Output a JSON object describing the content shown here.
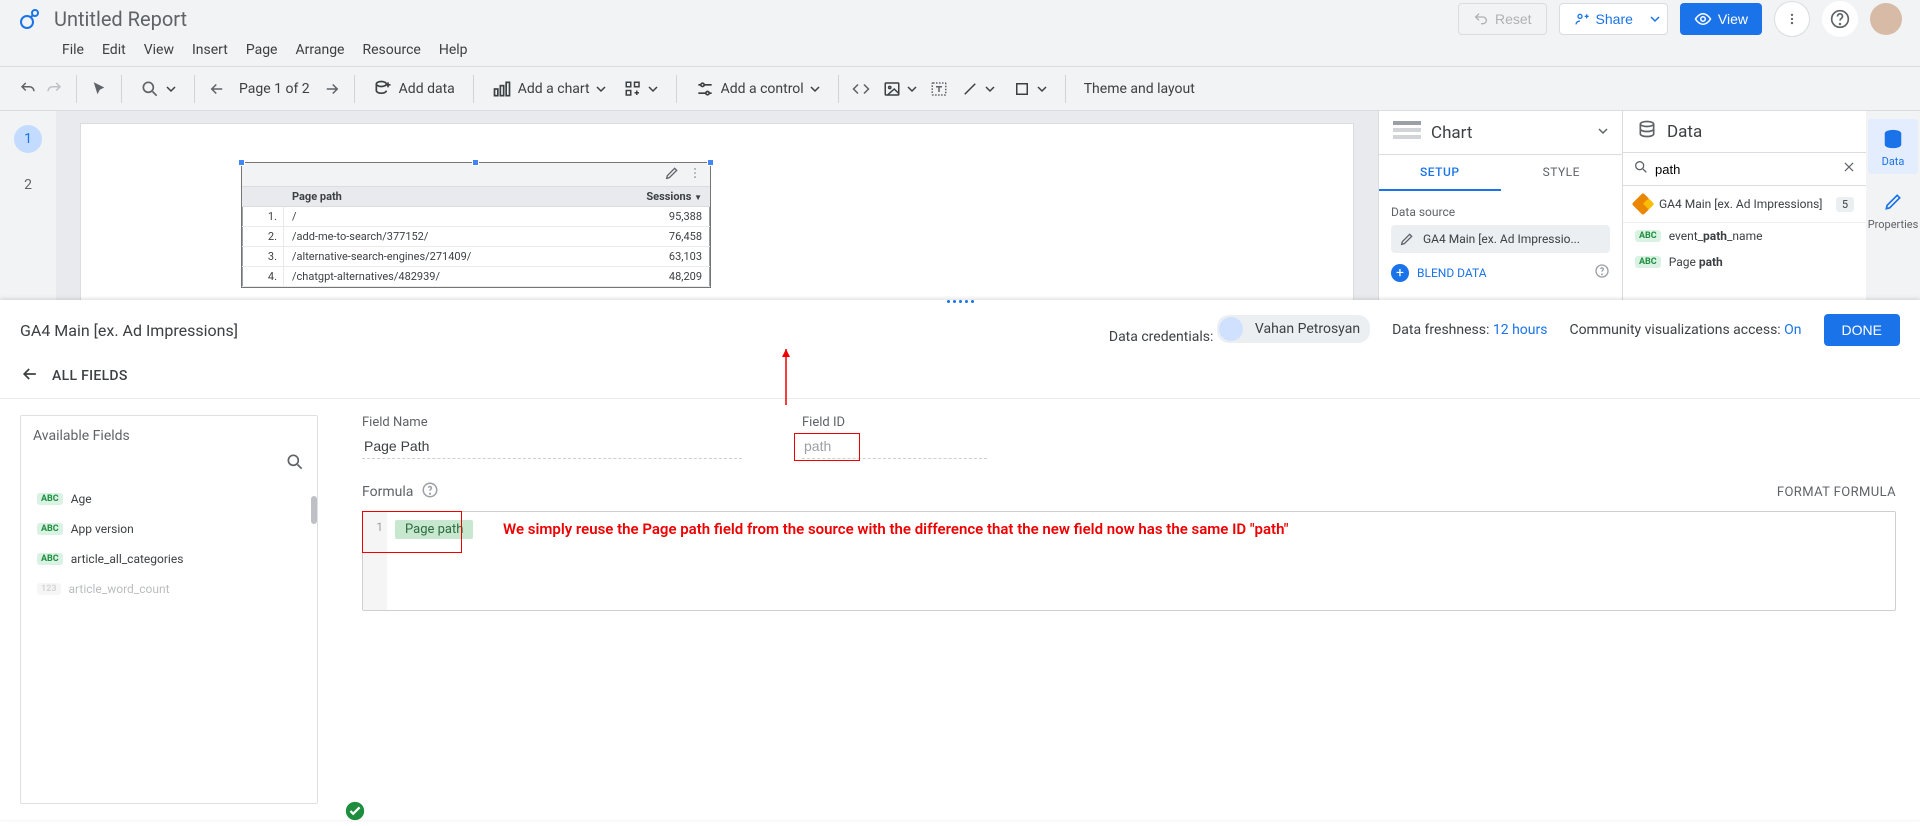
{
  "header": {
    "title": "Untitled Report",
    "reset": "Reset",
    "share": "Share",
    "view": "View"
  },
  "menus": [
    "File",
    "Edit",
    "View",
    "Insert",
    "Page",
    "Arrange",
    "Resource",
    "Help"
  ],
  "toolbar": {
    "page_counter": "Page 1 of 2",
    "add_data": "Add data",
    "add_chart": "Add a chart",
    "add_control": "Add a control",
    "theme": "Theme and layout"
  },
  "pages": {
    "active": "1",
    "other": "2"
  },
  "table": {
    "headers": {
      "c1": "Page path",
      "c2": "Sessions"
    },
    "rows": [
      {
        "idx": "1.",
        "path": "/",
        "sessions": "95,388"
      },
      {
        "idx": "2.",
        "path": "/add-me-to-search/377152/",
        "sessions": "76,458"
      },
      {
        "idx": "3.",
        "path": "/alternative-search-engines/271409/",
        "sessions": "63,103"
      },
      {
        "idx": "4.",
        "path": "/chatgpt-alternatives/482939/",
        "sessions": "48,209"
      }
    ]
  },
  "chart_panel": {
    "title": "Chart",
    "tabs": {
      "setup": "SETUP",
      "style": "STYLE"
    },
    "ds_label": "Data source",
    "ds_name": "GA4 Main [ex. Ad Impressio...",
    "blend": "BLEND DATA"
  },
  "data_panel": {
    "title": "Data",
    "search_value": "path",
    "source": "GA4 Main [ex. Ad Impressions]",
    "count": "5",
    "fields": [
      {
        "pre": "event_",
        "match": "path",
        "post": "_name"
      },
      {
        "pre": "Page ",
        "match": "path",
        "post": ""
      }
    ]
  },
  "rail": {
    "data": "Data",
    "props": "Properties"
  },
  "editor": {
    "source_name": "GA4 Main [ex. Ad Impressions]",
    "cred_label": "Data credentials:",
    "cred_user": "Vahan Petrosyan",
    "fresh_label": "Data freshness:",
    "fresh_value": "12 hours",
    "cvis_label": "Community visualizations access:",
    "cvis_value": "On",
    "done": "DONE",
    "all_fields": "ALL FIELDS",
    "avail_title": "Available Fields",
    "avail_fields": [
      "Age",
      "App version",
      "article_all_categories",
      "article_word_count"
    ],
    "field_name_label": "Field Name",
    "field_name_value": "Page Path",
    "field_id_label": "Field ID",
    "field_id_value": "path",
    "formula_label": "Formula",
    "format_formula": "FORMAT FORMULA",
    "formula_chip": "Page path",
    "gutter": "1",
    "annotation": "We simply reuse the Page path field from the source with the difference that the new field now has the same ID \"path\""
  }
}
